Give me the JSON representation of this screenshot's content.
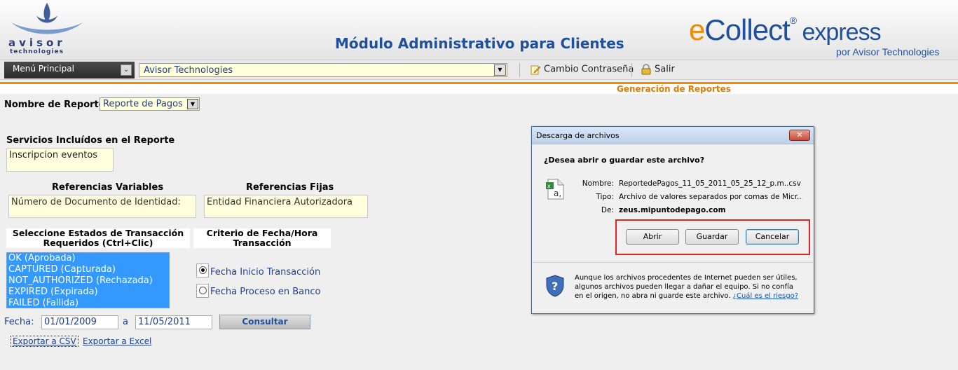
{
  "header": {
    "logo_word": "avisor",
    "logo_sub": "technologies",
    "app_title": "Módulo Administrativo para Clientes",
    "brand_e": "e",
    "brand_collect": "Collect",
    "brand_reg": "®",
    "brand_express": " express",
    "brand_sub": "por Avisor Technologies"
  },
  "menu": {
    "principal": "Menú Principal",
    "company": "Avisor Technologies",
    "cambio": "Cambio Contraseña",
    "salir": "Salir"
  },
  "section": {
    "title": "Generación de Reportes"
  },
  "form": {
    "nombre_label": "Nombre de Reporte:",
    "report_value": "Reporte de Pagos",
    "servicios_label": "Servicios Incluídos en el Reporte",
    "servicios_value": "Inscripcion eventos",
    "refvar_label": "Referencias Variables",
    "refvar_value": "Número de Documento de Identidad:",
    "reffij_label": "Referencias Fijas",
    "reffij_value": "Entidad Financiera Autorizadora",
    "estados_label": "Seleccione Estados de Transacción Requeridos (Ctrl+Clic)",
    "criterio_label": "Criterio de Fecha/Hora Transacción",
    "estados": [
      "OK (Aprobada)",
      "CAPTURED (Capturada)",
      "NOT_AUTHORIZED (Rechazada)",
      "EXPIRED (Expirada)",
      "FAILED (Fallida)"
    ],
    "radio1": "Fecha Inicio Transacción",
    "radio2": "Fecha Proceso en Banco",
    "fecha_label": "Fecha:",
    "fecha_from": "01/01/2009",
    "fecha_a": "a",
    "fecha_to": "11/05/2011",
    "consultar": "Consultar",
    "export_csv": "Exportar a CSV",
    "export_excel": "Exportar a Excel"
  },
  "dialog": {
    "title": "Descarga de archivos",
    "close": "✕",
    "question": "¿Desea abrir o guardar este archivo?",
    "nombre_k": "Nombre:",
    "nombre_v": "ReportedePagos_11_05_2011_05_25_12_p.m..csv",
    "tipo_k": "Tipo:",
    "tipo_v": "Archivo de valores separados por comas de Micr...",
    "de_k": "De:",
    "de_v": "zeus.mipuntodepago.com",
    "abrir": "Abrir",
    "guardar": "Guardar",
    "cancelar": "Cancelar",
    "warning": "Aunque los archivos procedentes de Internet pueden ser útiles, algunos archivos pueden llegar a dañar el equipo. Si no confía en el origen, no abra ni guarde este archivo.",
    "risk_link": "¿Cuál es el riesgo?"
  }
}
